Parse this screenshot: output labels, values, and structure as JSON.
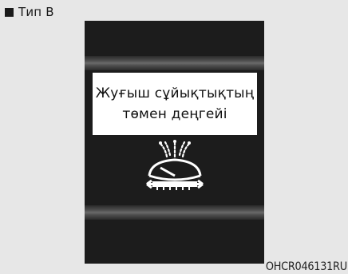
{
  "header": {
    "type_label": "Тип B"
  },
  "display": {
    "message_line1": "Жуғыш сұйықтықтың",
    "message_line2": "төмен деңгейі",
    "icon": "washer-fluid-icon"
  },
  "footer": {
    "image_code": "OHCR046131RU"
  },
  "colors": {
    "background": "#e7e7e7",
    "display_bg": "#1c1c1c",
    "message_bg": "#ffffff",
    "icon_color": "#ffffff"
  }
}
